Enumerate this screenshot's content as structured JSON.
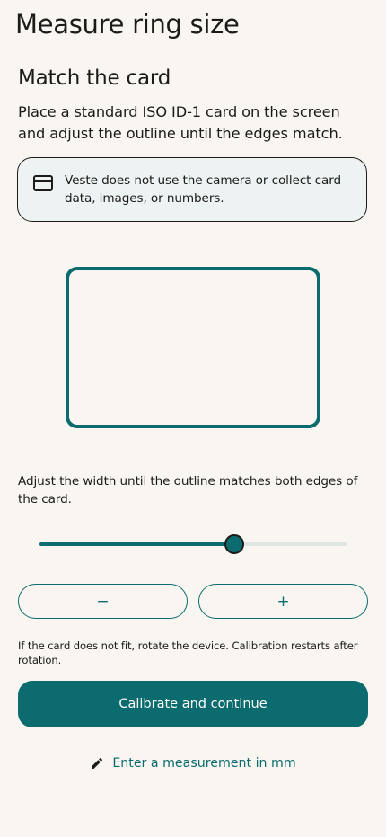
{
  "page": {
    "title": "Measure ring size"
  },
  "section": {
    "title": "Match the card",
    "intro": "Place a standard ISO ID-1 card on the screen and adjust the outline until the edges match."
  },
  "privacy_note": {
    "icon": "credit-card-icon",
    "text": "Veste does not use the camera or collect card data, images, or numbers."
  },
  "calibration": {
    "instruction": "Adjust the width until the outline matches both edges of the card.",
    "slider_value_fraction": 0.635,
    "decrease_label": "−",
    "increase_label": "+",
    "rotate_note": "If the card does not fit, rotate the device. Calibration restarts after rotation."
  },
  "actions": {
    "primary_label": "Calibrate and continue",
    "manual_entry_label": "Enter a measurement in mm",
    "manual_entry_icon": "pencil-icon"
  },
  "colors": {
    "background": "#f9f6f1",
    "accent": "#0b6b6e",
    "note_background": "#ecf3f2",
    "text": "#1c1b1a"
  }
}
